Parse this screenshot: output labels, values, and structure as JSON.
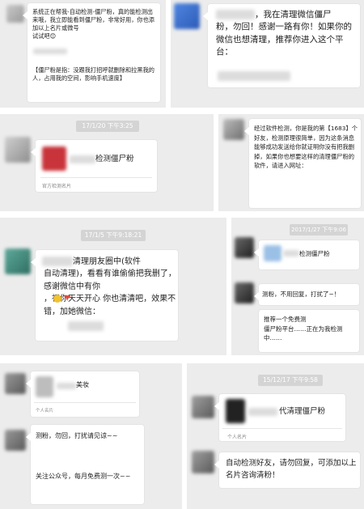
{
  "panel1": {
    "msg1": "系统正在帮我-自动检测-僵尸粉，真的能检测出来哦，我立即能看到僵尸粉，非常好用，你也添加以上名片或微号\n                试试吧😊",
    "msg2": "【僵尸粉是指：没跟我打招呼就删除和拉黑我的人，占用我的空间，影响手机速度】"
  },
  "panel2": {
    "msg": "，我在清理微信僵尸",
    "msg_cont": "粉，勿回！感谢一路有你！如果你的微信也想清理，推荐你进入这个平台："
  },
  "panel3": {
    "time": "17/1/20 下午3:25",
    "card_name": "检测僵尸粉",
    "card_footer": "官方检测名片"
  },
  "panel4": {
    "msg": "经过软件检测，你是我的第【1683】个好友，检测原理很简单，因为这条消息能够成功发送给你就证明你没有把我删掉，如果你也想要这样的清理僵尸粉的软件，请进入网址："
  },
  "panel5": {
    "time": "17/1/5 下午9:18:21",
    "msg": "清理朋友圈中(软件",
    "msg_cont": "自动清理)，看看有谁偷偷把我删了，感谢微信中有你\n     ，祝你天天开心    你也清清吧，效果不错，加她微信："
  },
  "panel6": {
    "time": "2017/1/27 下午9:06",
    "card_name": "检测僵尸粉",
    "msg1": "测粉，不用回复，打扰了~！",
    "msg2": "推荐一个免费测\n僵尸粉平台……正在为我检测中……"
  },
  "panel7": {
    "card_name": "美妆",
    "card_footer": "个人名片",
    "msg1": "测粉，勿回，打扰请见谅~~",
    "msg2": "关注公众号，每月免费测一次~~"
  },
  "panel8": {
    "time": "15/12/17 下午9:58",
    "card_name": "代清理僵尸粉",
    "card_footer": "个人名片",
    "msg": "自动检测好友，请勿回复，可添加以上名片咨询清粉！"
  }
}
